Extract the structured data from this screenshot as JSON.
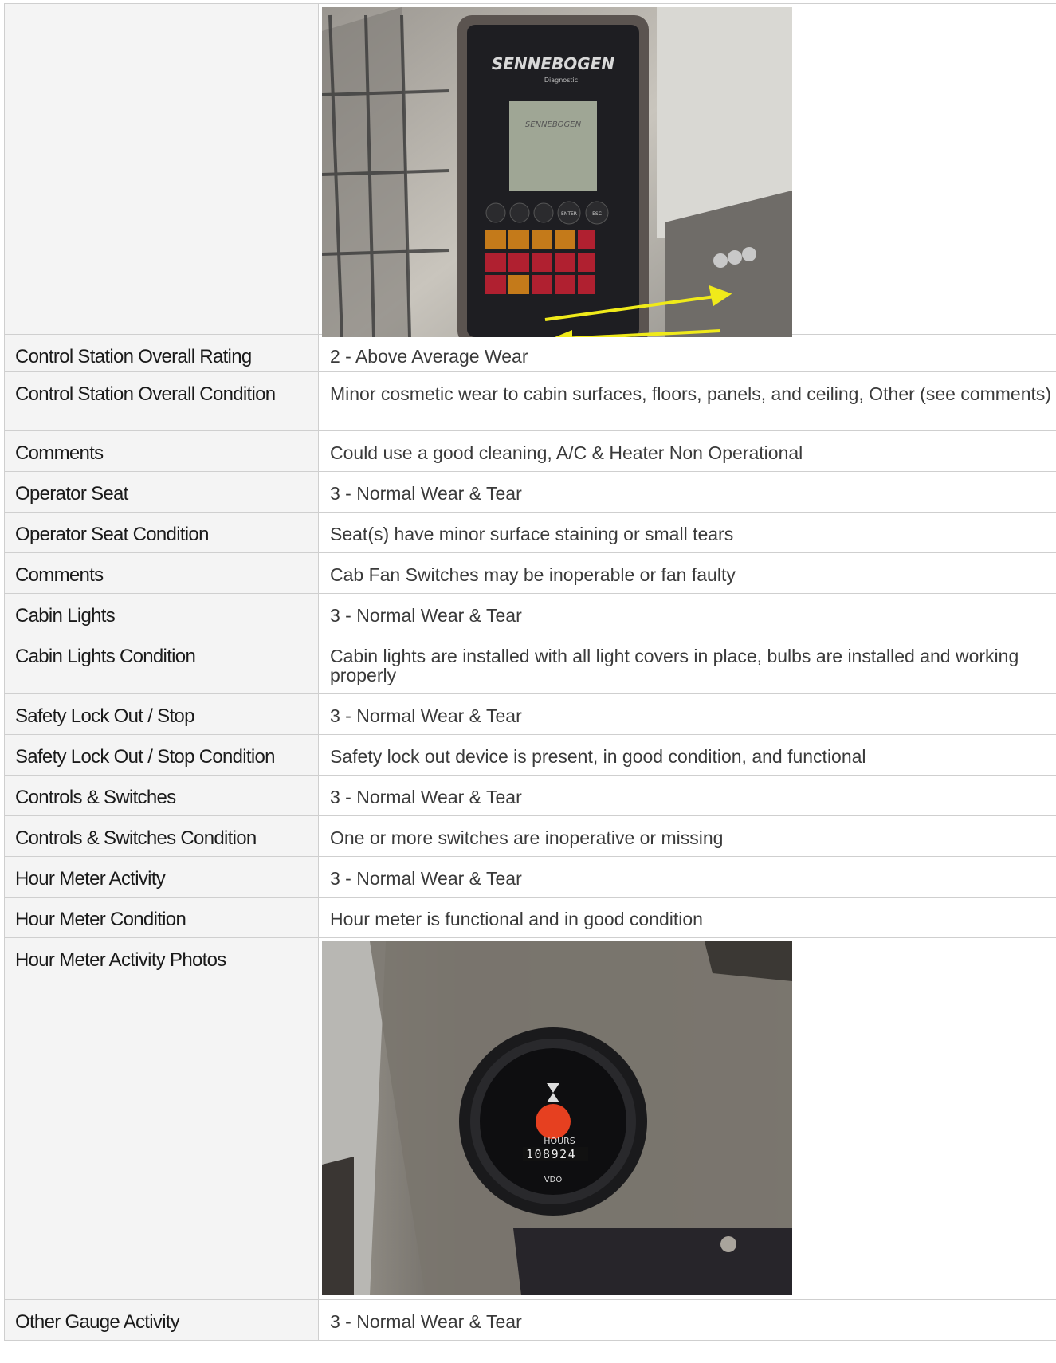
{
  "rows": [
    {
      "label": "",
      "photo": "display-panel-photo"
    },
    {
      "label": "Control Station Overall Rating",
      "value": "2 - Above Average Wear"
    },
    {
      "label": "Control Station Overall Condition",
      "value": "Minor cosmetic wear to cabin surfaces, floors, panels, and ceiling, Other (see comments)"
    },
    {
      "label": "Comments",
      "value": "Could use a good cleaning, A/C & Heater Non Operational"
    },
    {
      "label": "Operator Seat",
      "value": "3 - Normal Wear & Tear"
    },
    {
      "label": "Operator Seat Condition",
      "value": "Seat(s) have minor surface staining or small tears"
    },
    {
      "label": "Comments",
      "value": "Cab Fan Switches may be inoperable or fan faulty"
    },
    {
      "label": "Cabin Lights",
      "value": "3 - Normal Wear & Tear"
    },
    {
      "label": "Cabin Lights Condition",
      "value": "Cabin lights are installed with all light covers in place, bulbs are installed and working properly"
    },
    {
      "label": "Safety Lock Out / Stop",
      "value": "3 - Normal Wear & Tear"
    },
    {
      "label": "Safety Lock Out / Stop Condition",
      "value": "Safety lock out device is present, in good condition, and functional"
    },
    {
      "label": "Controls & Switches",
      "value": "3 - Normal Wear & Tear"
    },
    {
      "label": "Controls & Switches Condition",
      "value": "One or more switches are inoperative or missing"
    },
    {
      "label": "Hour Meter Activity",
      "value": "3 - Normal Wear & Tear"
    },
    {
      "label": "Hour Meter Condition",
      "value": "Hour meter is functional and in good condition"
    },
    {
      "label": "Hour Meter Activity Photos",
      "photo": "hour-meter-photo"
    },
    {
      "label": "Other Gauge Activity",
      "value": "3 - Normal Wear & Tear"
    }
  ],
  "photo1": {
    "brand": "SENNEBOGEN",
    "sub": "Diagnostic",
    "screen_brand": "SENNEBOGEN",
    "key_enter": "ENTER",
    "key_esc": "ESC"
  },
  "photo2": {
    "label": "HOURS",
    "digits": "108924",
    "brand": "VDO"
  }
}
